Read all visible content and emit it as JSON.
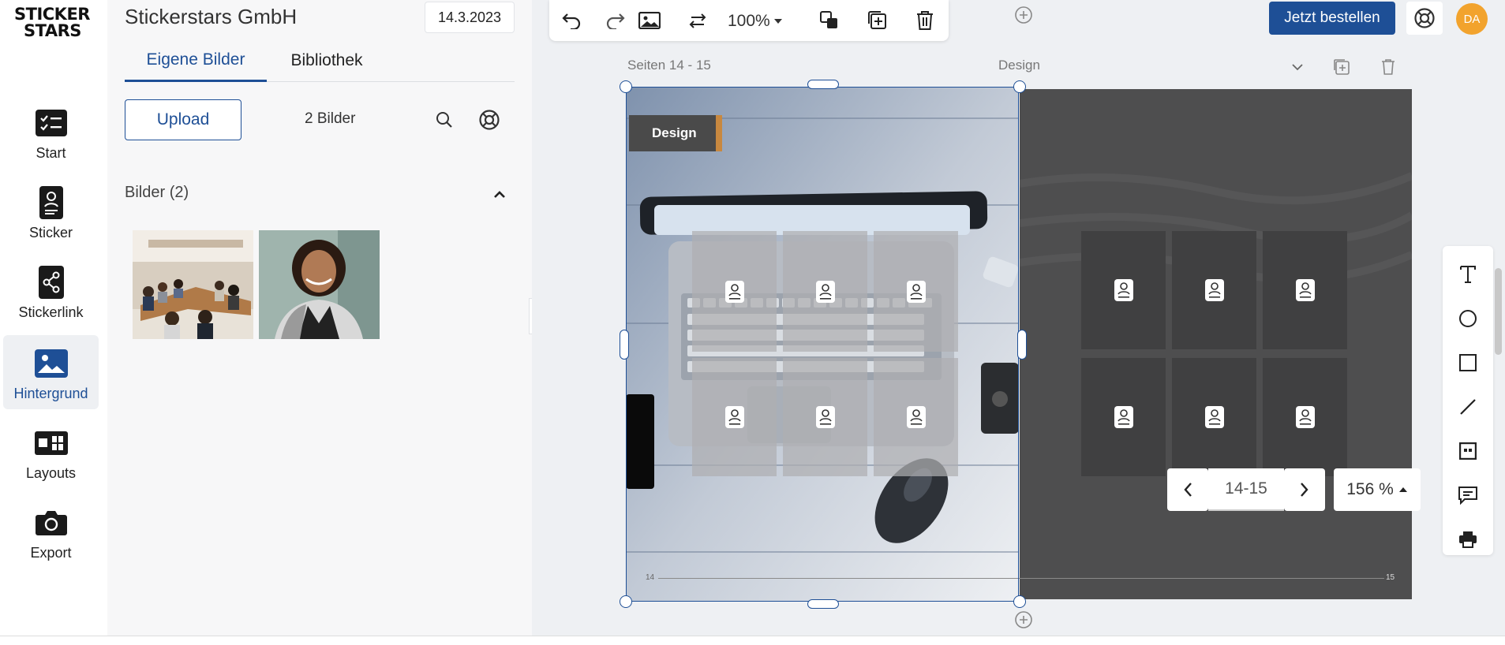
{
  "nav": {
    "logo_line1": "STICKER",
    "logo_line2": "STARS",
    "items": [
      {
        "label": "Start"
      },
      {
        "label": "Sticker"
      },
      {
        "label": "Stickerlink"
      },
      {
        "label": "Hintergrund"
      },
      {
        "label": "Layouts"
      },
      {
        "label": "Export"
      }
    ]
  },
  "panel": {
    "company": "Stickerstars GmbH",
    "date": "14.3.2023",
    "tabs": [
      {
        "label": "Eigene Bilder"
      },
      {
        "label": "Bibliothek"
      }
    ],
    "upload_label": "Upload",
    "image_count": "2 Bilder",
    "section_title": "Bilder (2)"
  },
  "toolbar": {
    "zoom": "100%"
  },
  "canvas": {
    "left_label": "Seiten 14 - 15",
    "right_label": "Design",
    "design_tag": "Design",
    "page_left_num": "14",
    "page_right_num": "15"
  },
  "header": {
    "order_label": "Jetzt bestellen",
    "avatar_initials": "DA"
  },
  "pager": {
    "pages": "14-15",
    "zoom_pct": "156 %"
  },
  "colors": {
    "accent": "#1e4f96",
    "avatar": "#f2a32d",
    "tag_stripe": "#c8883f"
  }
}
